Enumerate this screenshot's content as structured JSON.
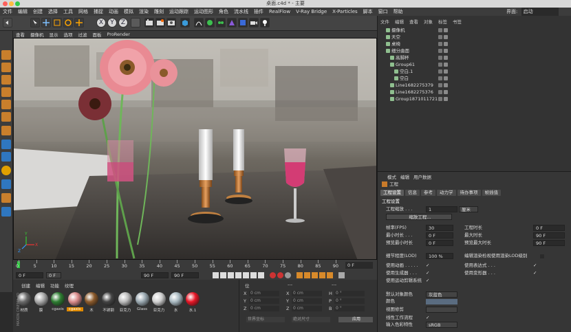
{
  "window": {
    "title": "桌面.c4d * - 主要"
  },
  "menu": {
    "items": [
      "文件",
      "编辑",
      "创建",
      "选择",
      "工具",
      "网格",
      "捕捉",
      "动画",
      "模拟",
      "渲染",
      "雕刻",
      "运动跟踪",
      "运动图形",
      "角色",
      "流水线",
      "插件",
      "RealFlow",
      "V-Ray Bridge",
      "X-Particles",
      "脚本",
      "窗口",
      "帮助"
    ],
    "layout_label": "界面:",
    "layout_value": "启动"
  },
  "viewport": {
    "menu": [
      "查看",
      "摄像机",
      "显示",
      "选项",
      "过滤",
      "面板",
      "ProRender"
    ],
    "gizmo": {
      "x": "X",
      "y": "Y",
      "z": "Z"
    }
  },
  "toolbar": {
    "axis": [
      "X",
      "Y",
      "Z"
    ]
  },
  "timeline": {
    "ticks": [
      "0",
      "5",
      "10",
      "15",
      "20",
      "25",
      "30",
      "35",
      "40",
      "45",
      "50",
      "55",
      "60",
      "65",
      "70",
      "75",
      "80",
      "85",
      "90"
    ],
    "end_label": "0 F"
  },
  "transport": {
    "start": "0 F",
    "current": "0 F",
    "end1": "90 F",
    "end2": "90 F"
  },
  "materials": {
    "menu": [
      "创建",
      "编辑",
      "功能",
      "纹理"
    ],
    "items": [
      {
        "label": "材质",
        "color": "#6a6a6a"
      },
      {
        "label": "膜",
        "color": "#aaaaaa"
      },
      {
        "label": "cgaxis",
        "color": "#2e7d32"
      },
      {
        "label": "cgaxis",
        "color": "#d88a8a",
        "selected": true
      },
      {
        "label": "木",
        "color": "#8b5a2b"
      },
      {
        "label": "不锈钢",
        "color": "#444444"
      },
      {
        "label": "亚克力",
        "color": "#bbbbbb"
      },
      {
        "label": "Glass",
        "color": "#9aa8b0"
      },
      {
        "label": "亚克力",
        "color": "#cfcfcf"
      },
      {
        "label": "水",
        "color": "#a8b8c0"
      },
      {
        "label": "水.1",
        "color": "#e81626"
      }
    ],
    "brand": "MAXON CINEMA 4D"
  },
  "coordinates": {
    "headers": [
      "位",
      "---",
      "---"
    ],
    "rows": [
      {
        "a": "X",
        "av": "0 cm",
        "b": "X",
        "bv": "0 cm",
        "c": "H",
        "cv": "0 °"
      },
      {
        "a": "Y",
        "av": "0 cm",
        "b": "Y",
        "bv": "0 cm",
        "c": "P",
        "cv": "0 °"
      },
      {
        "a": "Z",
        "av": "0 cm",
        "b": "Z",
        "bv": "0 cm",
        "c": "B",
        "cv": "0 °"
      }
    ],
    "dropdown1": "世界坐标",
    "dropdown2": "绝对尺寸",
    "apply": "应用"
  },
  "object_manager": {
    "tabs": [
      "文件",
      "编辑",
      "查看",
      "对象",
      "标签",
      "书签"
    ],
    "objects": [
      {
        "name": "摄像机",
        "indent": 0
      },
      {
        "name": "天空",
        "indent": 0
      },
      {
        "name": "桌椅",
        "indent": 0
      },
      {
        "name": "细分曲面",
        "indent": 0
      },
      {
        "name": "高脚杯",
        "indent": 1
      },
      {
        "name": "Group61",
        "indent": 1
      },
      {
        "name": "空白.1",
        "indent": 2
      },
      {
        "name": "空白",
        "indent": 2
      },
      {
        "name": "Line1682275379",
        "indent": 1
      },
      {
        "name": "Line1682275376",
        "indent": 1
      },
      {
        "name": "Group1871011721",
        "indent": 1
      }
    ]
  },
  "attributes": {
    "menu": [
      "模式",
      "编辑",
      "用户数据"
    ],
    "title": "工程",
    "tabs": [
      "工程设置",
      "信息",
      "参考",
      "动力学",
      "待办事项",
      "帧插值"
    ],
    "section": "工程设置",
    "scale_label": "工程缩放 . . .",
    "scale_value": "1",
    "scale_unit": "厘米",
    "scale_btn": "缩放工程...",
    "left": [
      {
        "label": "帧率(FPS)",
        "value": "30"
      },
      {
        "label": "最小时长 . . .",
        "value": "0 F"
      },
      {
        "label": "预览最小时长",
        "value": "0 F"
      }
    ],
    "right": [
      {
        "label": "工程时长",
        "value": "0 F"
      },
      {
        "label": "最大时长",
        "value": "90 F"
      },
      {
        "label": "预览最大时长",
        "value": "90 F"
      }
    ],
    "lod_label": "细节程度(LOD)",
    "lod_value": "100 %",
    "lod_check": "编辑渲染检视使用渲染LOD级别",
    "checks_left": [
      "使用动画 . . . . .",
      "使用生成器 . . .",
      "使用运动剪辑系统"
    ],
    "checks_right": [
      "使用表达式 . . .",
      "使用变形器 . . ."
    ],
    "default_color_label": "默认对象颜色",
    "default_color_value": "灰蓝色",
    "color_label": "颜色",
    "view_clip_label": "视图修剪",
    "linear_label": "线性工作流程",
    "input_color_label": "输入色彩特性",
    "input_color_value": "sRGB"
  }
}
